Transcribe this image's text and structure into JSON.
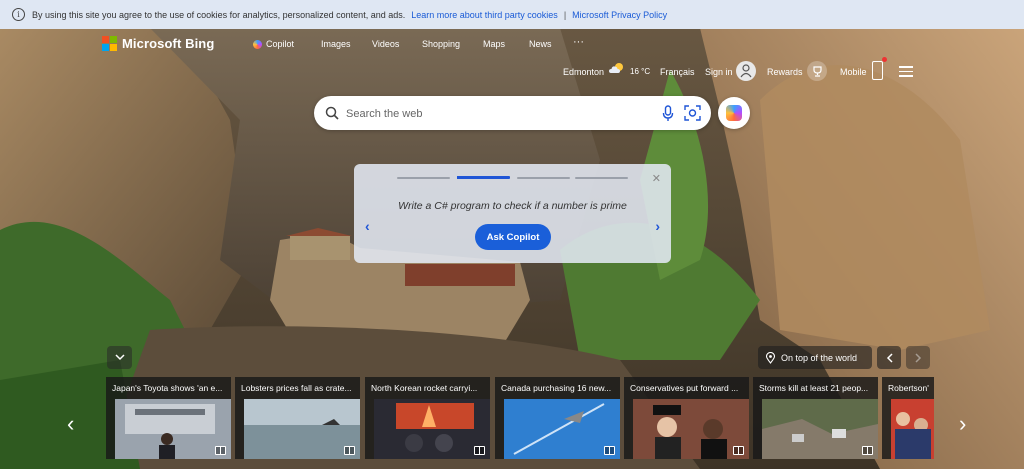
{
  "cookie": {
    "text": "By using this site you agree to the use of cookies for analytics, personalized content, and ads.",
    "link1": "Learn more about third party cookies",
    "sep": "|",
    "link2": "Microsoft Privacy Policy"
  },
  "brand": "Microsoft Bing",
  "nav": [
    "Copilot",
    "Images",
    "Videos",
    "Shopping",
    "Maps",
    "News",
    "···"
  ],
  "header_right": {
    "city": "Edmonton",
    "temp": "16 °C",
    "language": "Français",
    "sign_in": "Sign in",
    "rewards": "Rewards",
    "mobile": "Mobile"
  },
  "search": {
    "placeholder": "Search the web"
  },
  "prompt_card": {
    "text": "Write a C# program to check if a number is prime",
    "button": "Ask Copilot",
    "close": "✕",
    "prev": "‹",
    "next": "›",
    "progress": {
      "slides": 4,
      "active": 2
    }
  },
  "location": "On top of the world",
  "news": [
    "Japan's Toyota shows 'an e...",
    "Lobsters prices fall as crate...",
    "North Korean rocket carryi...",
    "Canada purchasing 16 new...",
    "Conservatives put forward ...",
    "Storms kill at least 21 peop...",
    "Robertson'"
  ],
  "colors": {
    "accent": "#1a5fd9",
    "cookie_bg": "#dfe7f3",
    "link": "#1a5bd6"
  }
}
